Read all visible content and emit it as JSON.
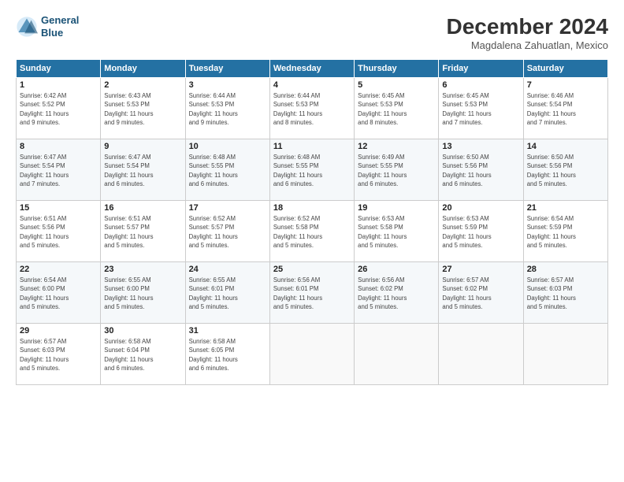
{
  "logo": {
    "line1": "General",
    "line2": "Blue"
  },
  "title": "December 2024",
  "subtitle": "Magdalena Zahuatlan, Mexico",
  "days_of_week": [
    "Sunday",
    "Monday",
    "Tuesday",
    "Wednesday",
    "Thursday",
    "Friday",
    "Saturday"
  ],
  "weeks": [
    [
      {
        "day": "1",
        "info": "Sunrise: 6:42 AM\nSunset: 5:52 PM\nDaylight: 11 hours\nand 9 minutes."
      },
      {
        "day": "2",
        "info": "Sunrise: 6:43 AM\nSunset: 5:53 PM\nDaylight: 11 hours\nand 9 minutes."
      },
      {
        "day": "3",
        "info": "Sunrise: 6:44 AM\nSunset: 5:53 PM\nDaylight: 11 hours\nand 9 minutes."
      },
      {
        "day": "4",
        "info": "Sunrise: 6:44 AM\nSunset: 5:53 PM\nDaylight: 11 hours\nand 8 minutes."
      },
      {
        "day": "5",
        "info": "Sunrise: 6:45 AM\nSunset: 5:53 PM\nDaylight: 11 hours\nand 8 minutes."
      },
      {
        "day": "6",
        "info": "Sunrise: 6:45 AM\nSunset: 5:53 PM\nDaylight: 11 hours\nand 7 minutes."
      },
      {
        "day": "7",
        "info": "Sunrise: 6:46 AM\nSunset: 5:54 PM\nDaylight: 11 hours\nand 7 minutes."
      }
    ],
    [
      {
        "day": "8",
        "info": "Sunrise: 6:47 AM\nSunset: 5:54 PM\nDaylight: 11 hours\nand 7 minutes."
      },
      {
        "day": "9",
        "info": "Sunrise: 6:47 AM\nSunset: 5:54 PM\nDaylight: 11 hours\nand 6 minutes."
      },
      {
        "day": "10",
        "info": "Sunrise: 6:48 AM\nSunset: 5:55 PM\nDaylight: 11 hours\nand 6 minutes."
      },
      {
        "day": "11",
        "info": "Sunrise: 6:48 AM\nSunset: 5:55 PM\nDaylight: 11 hours\nand 6 minutes."
      },
      {
        "day": "12",
        "info": "Sunrise: 6:49 AM\nSunset: 5:55 PM\nDaylight: 11 hours\nand 6 minutes."
      },
      {
        "day": "13",
        "info": "Sunrise: 6:50 AM\nSunset: 5:56 PM\nDaylight: 11 hours\nand 6 minutes."
      },
      {
        "day": "14",
        "info": "Sunrise: 6:50 AM\nSunset: 5:56 PM\nDaylight: 11 hours\nand 5 minutes."
      }
    ],
    [
      {
        "day": "15",
        "info": "Sunrise: 6:51 AM\nSunset: 5:56 PM\nDaylight: 11 hours\nand 5 minutes."
      },
      {
        "day": "16",
        "info": "Sunrise: 6:51 AM\nSunset: 5:57 PM\nDaylight: 11 hours\nand 5 minutes."
      },
      {
        "day": "17",
        "info": "Sunrise: 6:52 AM\nSunset: 5:57 PM\nDaylight: 11 hours\nand 5 minutes."
      },
      {
        "day": "18",
        "info": "Sunrise: 6:52 AM\nSunset: 5:58 PM\nDaylight: 11 hours\nand 5 minutes."
      },
      {
        "day": "19",
        "info": "Sunrise: 6:53 AM\nSunset: 5:58 PM\nDaylight: 11 hours\nand 5 minutes."
      },
      {
        "day": "20",
        "info": "Sunrise: 6:53 AM\nSunset: 5:59 PM\nDaylight: 11 hours\nand 5 minutes."
      },
      {
        "day": "21",
        "info": "Sunrise: 6:54 AM\nSunset: 5:59 PM\nDaylight: 11 hours\nand 5 minutes."
      }
    ],
    [
      {
        "day": "22",
        "info": "Sunrise: 6:54 AM\nSunset: 6:00 PM\nDaylight: 11 hours\nand 5 minutes."
      },
      {
        "day": "23",
        "info": "Sunrise: 6:55 AM\nSunset: 6:00 PM\nDaylight: 11 hours\nand 5 minutes."
      },
      {
        "day": "24",
        "info": "Sunrise: 6:55 AM\nSunset: 6:01 PM\nDaylight: 11 hours\nand 5 minutes."
      },
      {
        "day": "25",
        "info": "Sunrise: 6:56 AM\nSunset: 6:01 PM\nDaylight: 11 hours\nand 5 minutes."
      },
      {
        "day": "26",
        "info": "Sunrise: 6:56 AM\nSunset: 6:02 PM\nDaylight: 11 hours\nand 5 minutes."
      },
      {
        "day": "27",
        "info": "Sunrise: 6:57 AM\nSunset: 6:02 PM\nDaylight: 11 hours\nand 5 minutes."
      },
      {
        "day": "28",
        "info": "Sunrise: 6:57 AM\nSunset: 6:03 PM\nDaylight: 11 hours\nand 5 minutes."
      }
    ],
    [
      {
        "day": "29",
        "info": "Sunrise: 6:57 AM\nSunset: 6:03 PM\nDaylight: 11 hours\nand 5 minutes."
      },
      {
        "day": "30",
        "info": "Sunrise: 6:58 AM\nSunset: 6:04 PM\nDaylight: 11 hours\nand 6 minutes."
      },
      {
        "day": "31",
        "info": "Sunrise: 6:58 AM\nSunset: 6:05 PM\nDaylight: 11 hours\nand 6 minutes."
      },
      {
        "day": "",
        "info": ""
      },
      {
        "day": "",
        "info": ""
      },
      {
        "day": "",
        "info": ""
      },
      {
        "day": "",
        "info": ""
      }
    ]
  ]
}
